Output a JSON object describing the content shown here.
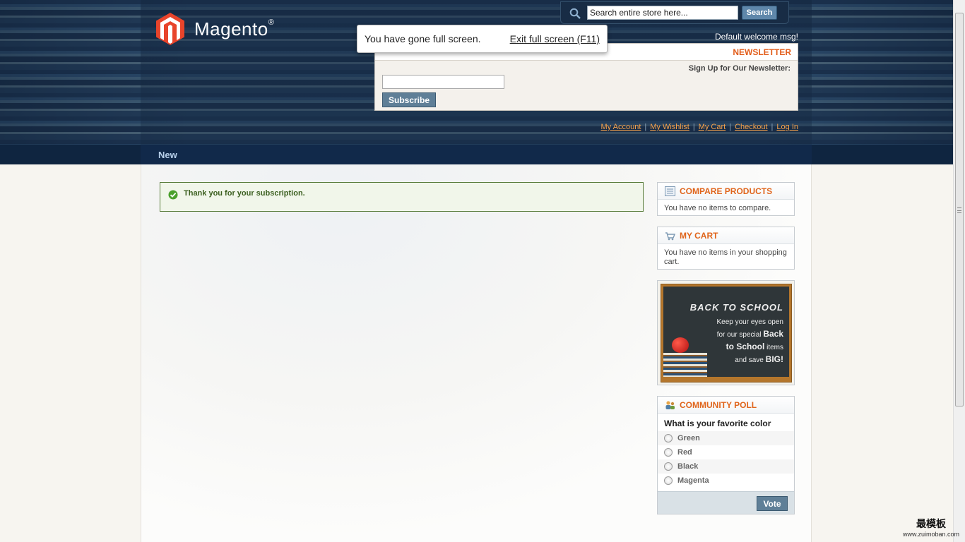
{
  "header": {
    "logo_text": "Magento",
    "logo_reg": "®",
    "search_placeholder": "Search entire store here...",
    "search_button": "Search",
    "welcome": "Default welcome msg!",
    "links": [
      "My Account",
      "My Wishlist",
      "My Cart",
      "Checkout",
      "Log In"
    ]
  },
  "fullscreen_tip": {
    "message": "You have gone full screen.",
    "exit": "Exit full screen (F11)"
  },
  "newsletter": {
    "title": "NEWSLETTER",
    "label": "Sign Up for Our Newsletter:",
    "button": "Subscribe"
  },
  "nav": {
    "item": "New"
  },
  "message": {
    "text": "Thank you for your subscription."
  },
  "compare": {
    "title": "COMPARE PRODUCTS",
    "body": "You have no items to compare."
  },
  "cart": {
    "title": "MY CART",
    "body": "You have no items in your shopping cart."
  },
  "banner": {
    "title": "BACK TO SCHOOL",
    "line1": "Keep your eyes open",
    "line2a": "for our special ",
    "line2b": "Back",
    "line3a": "to School",
    "line3b": " items",
    "line4a": "and save ",
    "line4b": "BIG!"
  },
  "poll": {
    "title": "COMMUNITY POLL",
    "question": "What is your favorite color",
    "options": [
      "Green",
      "Red",
      "Black",
      "Magenta"
    ],
    "button": "Vote"
  },
  "watermark": {
    "cn": "最模板",
    "url": "www.zuimoban.com"
  },
  "colors": {
    "accent_orange": "#e0651c",
    "link_orange": "#f5a14b",
    "button_blue": "#5f7f97",
    "success_green": "#3b5f1f"
  }
}
